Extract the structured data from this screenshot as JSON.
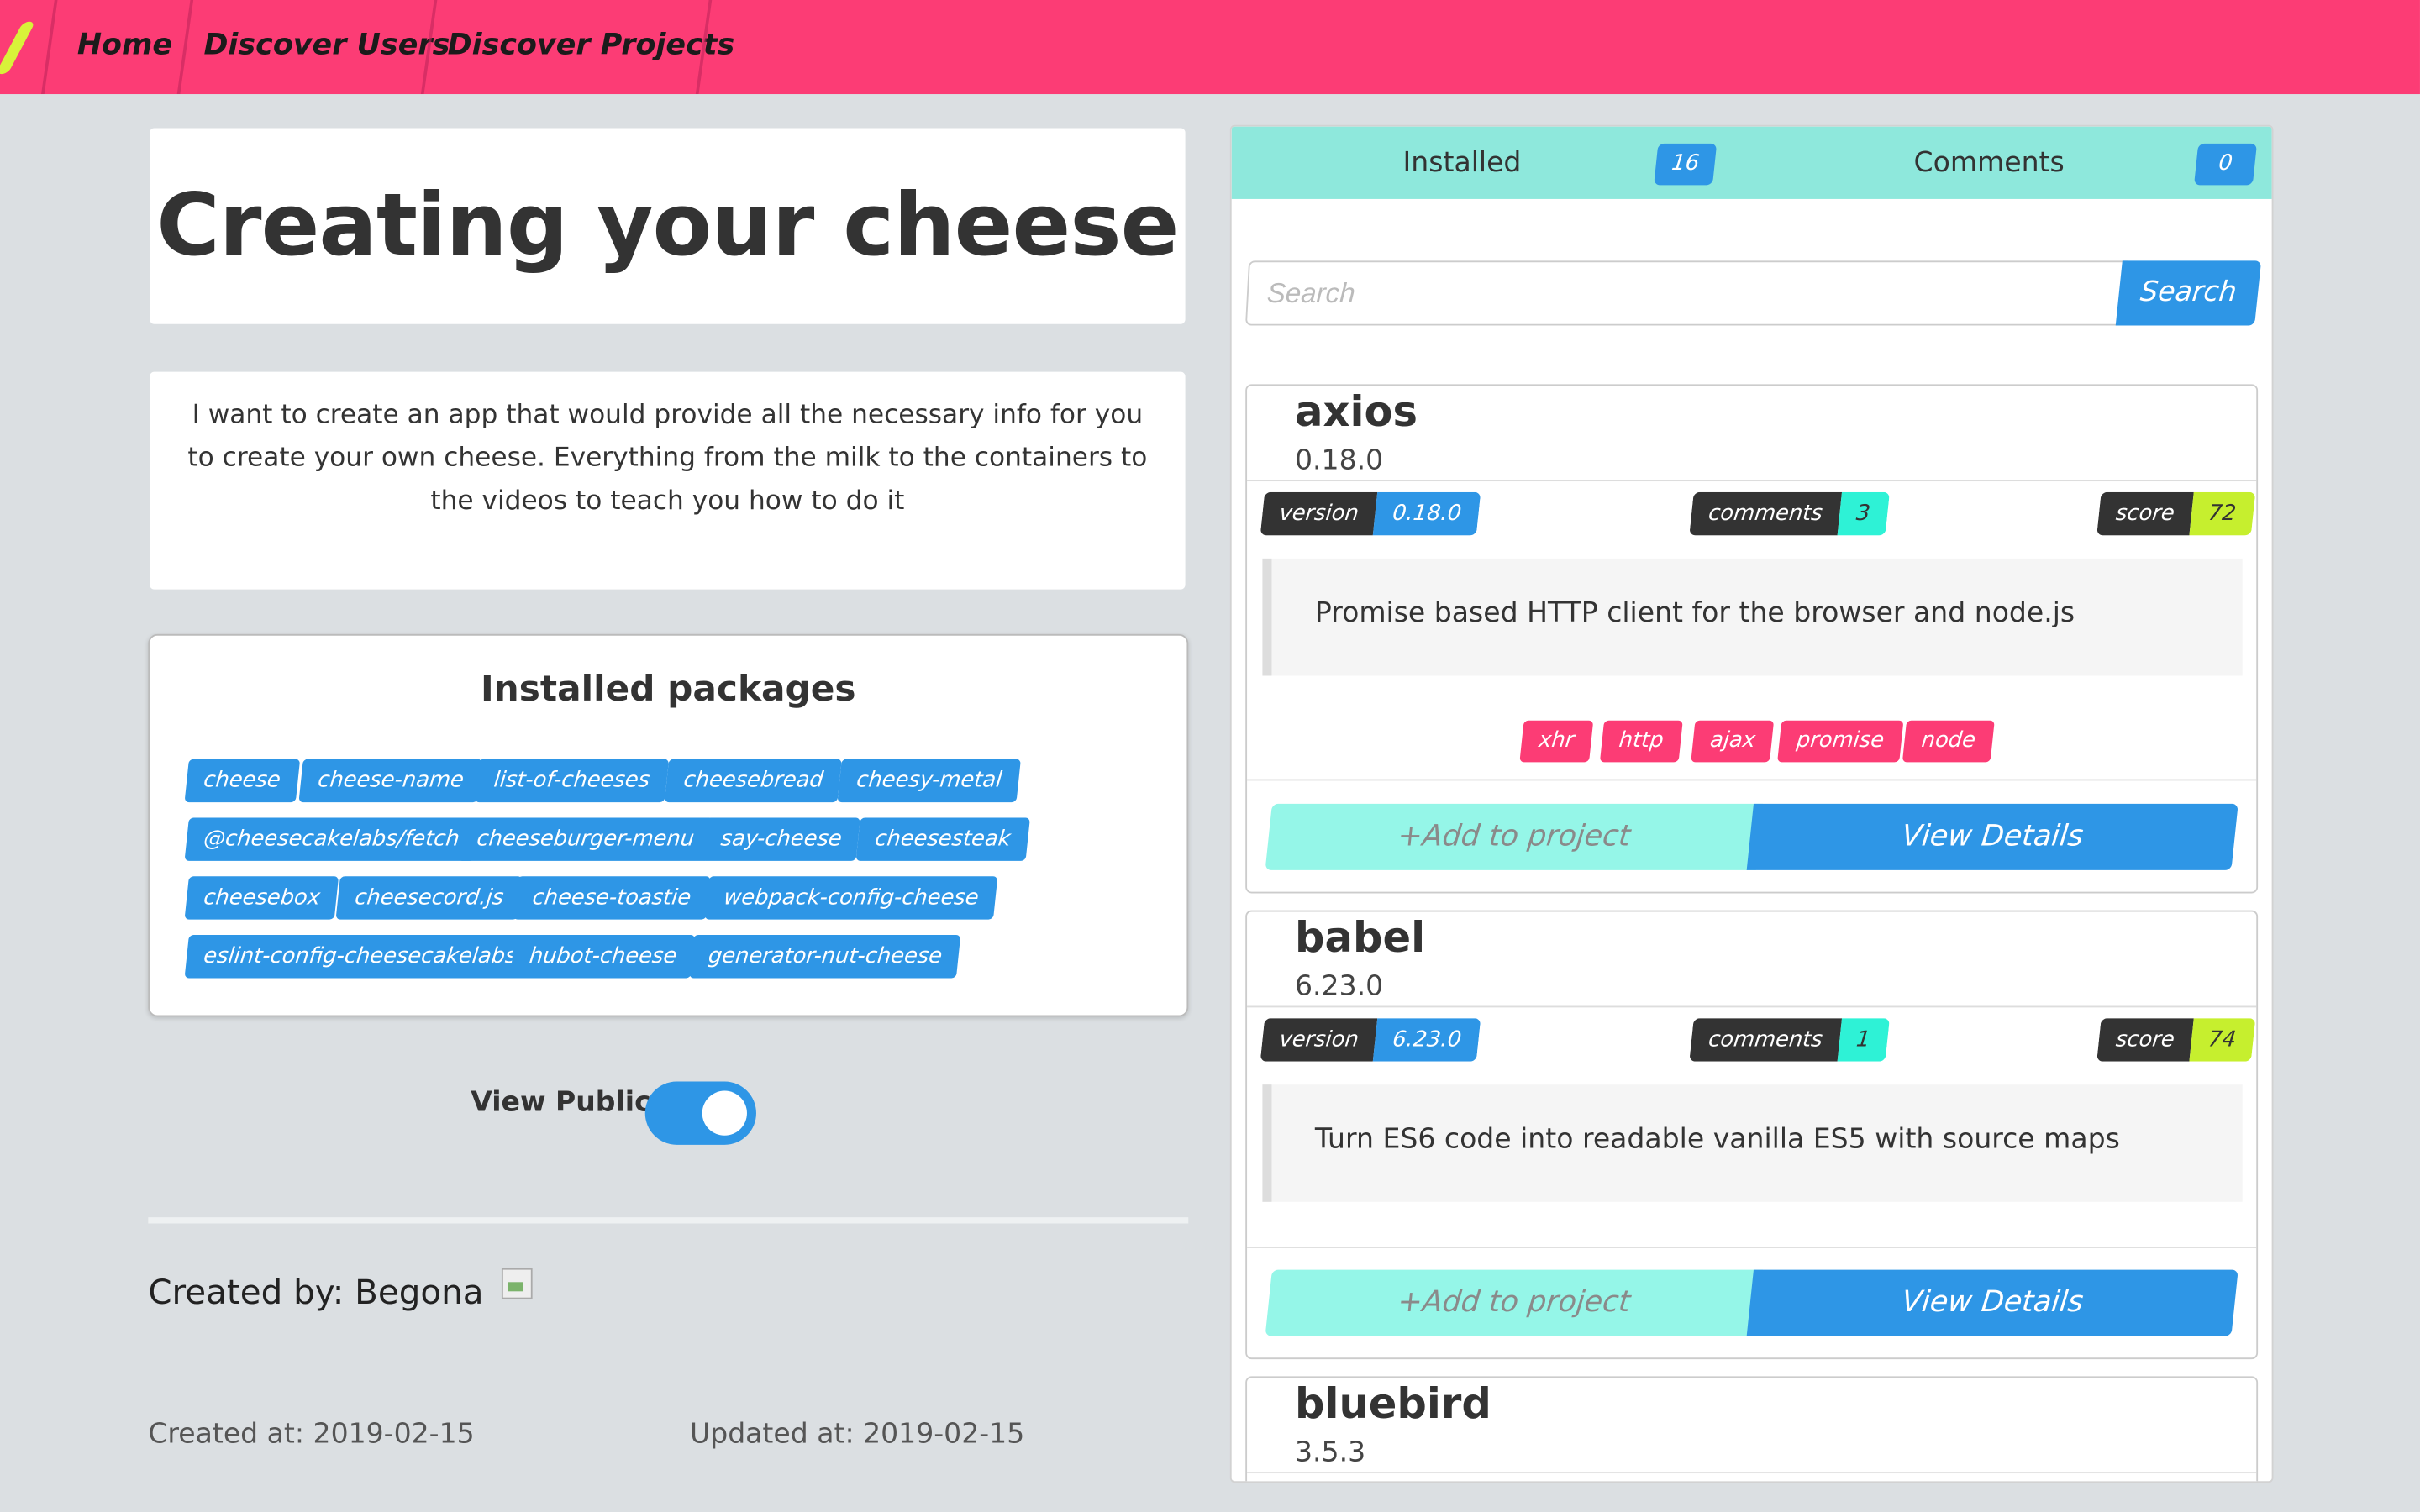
{
  "nav": {
    "links": [
      "Home",
      "Discover Users",
      "Discover Projects"
    ]
  },
  "project": {
    "title": "Creating your cheese",
    "description": "I want to create an app that would provide all the necessary info for you to create  your own cheese. Everything from the milk to the containers to the videos to teach you how to do it",
    "installed_heading": "Installed packages",
    "installed_packages": [
      "cheese",
      "cheese-name",
      "list-of-cheeses",
      "cheesebread",
      "cheesy-metal",
      "@cheesecakelabs/fetch",
      "cheeseburger-menu",
      "say-cheese",
      "cheesesteak",
      "cheesebox",
      "cheesecord.js",
      "cheese-toastie",
      "webpack-config-cheese",
      "eslint-config-cheesecakelabs",
      "hubot-cheese",
      "generator-nut-cheese"
    ],
    "view_public_label": "View Public",
    "view_public_on": true,
    "created_by": "Created by: Begona",
    "created_at": "Created at: 2019-02-15",
    "updated_at": "Updated at: 2019-02-15"
  },
  "panel": {
    "tabs": [
      {
        "label": "Installed",
        "count": "16"
      },
      {
        "label": "Comments",
        "count": "0"
      }
    ],
    "search_placeholder": "Search",
    "search_button": "Search",
    "add_label": "+Add to project",
    "view_label": "View Details",
    "version_key": "version",
    "comments_key": "comments",
    "score_key": "score",
    "packages": [
      {
        "name": "axios",
        "version": "0.18.0",
        "comments": "3",
        "score": "72",
        "description": "Promise based HTTP client for the browser and node.js",
        "keywords": [
          "xhr",
          "http",
          "ajax",
          "promise",
          "node"
        ]
      },
      {
        "name": "babel",
        "version": "6.23.0",
        "comments": "1",
        "score": "74",
        "description": "Turn ES6 code into readable vanilla ES5 with source maps",
        "keywords": []
      },
      {
        "name": "bluebird",
        "version": "3.5.3"
      }
    ]
  },
  "colors": {
    "nav_bg": "#fc3c75",
    "accent_blue": "#2e96e6",
    "tab_bg": "#8ee8dc",
    "comments_teal": "#2ef2d6",
    "score_lime": "#c6ef2e"
  }
}
